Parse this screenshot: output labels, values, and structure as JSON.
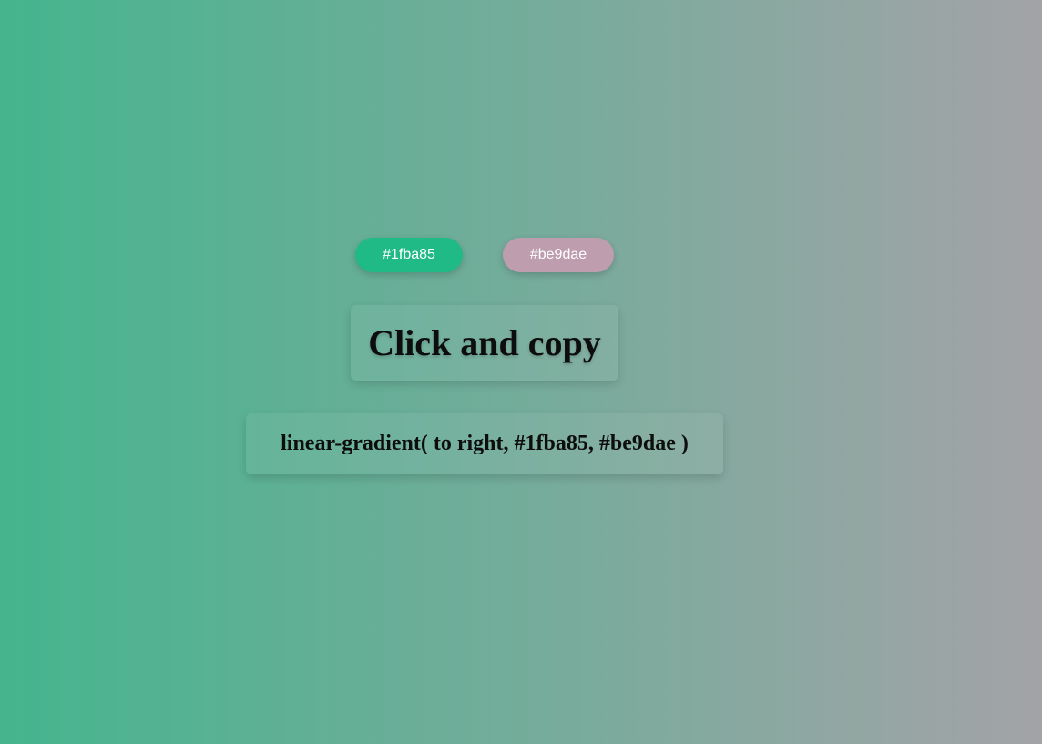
{
  "colors": {
    "first": "#1fba85",
    "second": "#be9dae"
  },
  "copy_card": {
    "label": "Click and copy"
  },
  "gradient_card": {
    "text": "linear-gradient( to right, #1fba85, #be9dae )"
  }
}
